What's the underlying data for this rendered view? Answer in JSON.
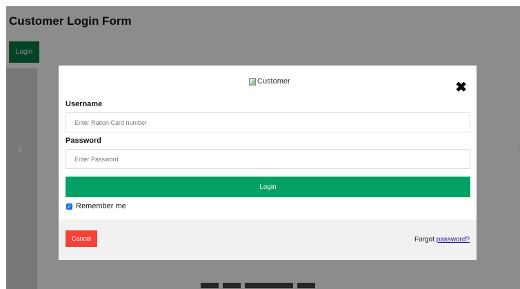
{
  "page": {
    "title": "Customer Login Form",
    "login_button": "Login",
    "prev_arrow": "‹",
    "next_arrow": "›"
  },
  "modal": {
    "logo_alt": "Customer",
    "close_glyph": "✖",
    "username": {
      "label": "Username",
      "placeholder": "Enter Ration Card number",
      "value": ""
    },
    "password": {
      "label": "Password",
      "placeholder": "Enter Password",
      "value": ""
    },
    "submit_label": "Login",
    "remember": {
      "label": "Remember me",
      "checked": true,
      "check_glyph": "✓"
    },
    "footer": {
      "cancel_label": "Cancel",
      "forgot_prefix": "Forgot ",
      "forgot_link": "password?"
    }
  },
  "colors": {
    "page_login_button": "#0b7a46",
    "submit_button": "#04a164",
    "cancel_button": "#f44336",
    "link": "#1a0dab",
    "checkbox": "#1a73e8"
  }
}
